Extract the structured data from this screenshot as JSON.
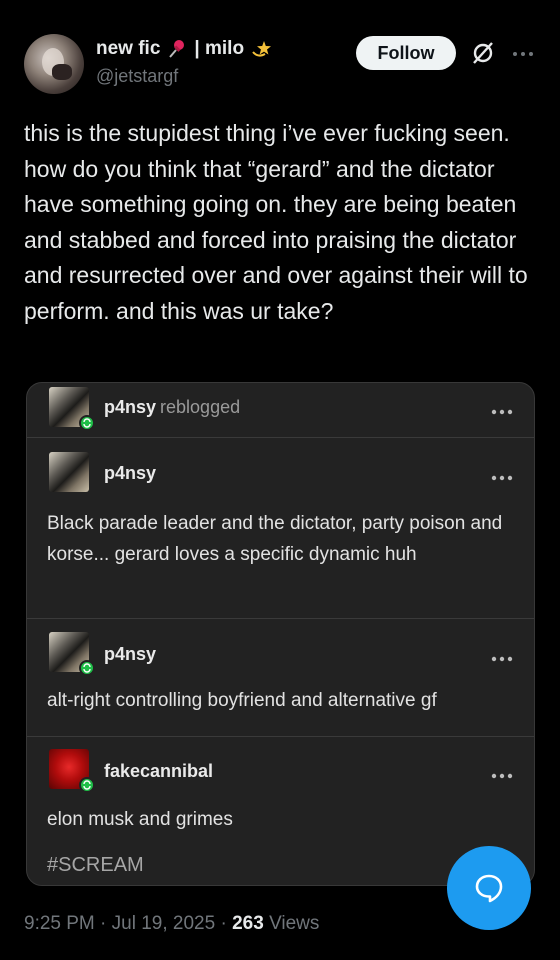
{
  "author": {
    "display_name": "new fic",
    "name_suffix": "| milo",
    "handle": "@jetstargf",
    "name_icons": [
      "pushpin-icon",
      "dizzy-star-icon"
    ]
  },
  "header": {
    "follow_label": "Follow",
    "grok_icon": "grok-icon",
    "more_icon": "more-horizontal-icon"
  },
  "tweet": {
    "text": "this is the stupidest thing i’ve ever fucking seen. how do you think that “gerard” and the dictator have something going on. they are being beaten and stabbed and forced into praising the dictator and resurrected over and over against their will to perform. and this was ur take?"
  },
  "quoted_post": {
    "reblog_header": {
      "user": "p4nsy",
      "action": "reblogged"
    },
    "posts": [
      {
        "user": "p4nsy",
        "text": "Black parade leader and the dictator, party poison and korse... gerard loves a specific dynamic huh"
      },
      {
        "user": "p4nsy",
        "text": "alt-right controlling boyfriend and alternative gf"
      },
      {
        "user": "fakecannibal",
        "text": "elon musk and grimes"
      }
    ],
    "tag": "#SCREAM"
  },
  "meta": {
    "time": "9:25 PM",
    "separator": "·",
    "date": "Jul 19, 2025",
    "views_count": "263",
    "views_label": "Views"
  },
  "fab_icon": "reply-bubble-icon",
  "colors": {
    "accent": "#1d9bf0",
    "repost_badge": "#1fbf48",
    "background": "#000000",
    "card": "#222222"
  }
}
